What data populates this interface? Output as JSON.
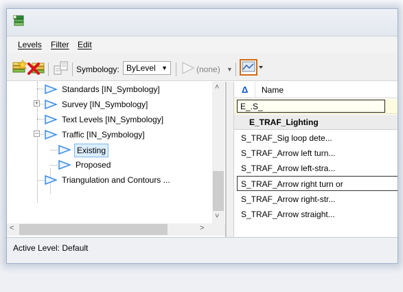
{
  "menu": {
    "levels": "Levels",
    "filter": "Filter",
    "edit": "Edit"
  },
  "toolbar": {
    "symbology_label": "Symbology:",
    "symbology_value": "ByLevel",
    "filter_value": "(none)"
  },
  "tree": {
    "items": [
      {
        "label": "Standards [IN_Symbology]"
      },
      {
        "label": "Survey [IN_Symbology]"
      },
      {
        "label": "Text Levels [IN_Symbology]"
      },
      {
        "label": "Traffic [IN_Symbology]"
      },
      {
        "label": "Existing"
      },
      {
        "label": "Proposed"
      },
      {
        "label": "Triangulation and Contours ..."
      }
    ],
    "expander_plus": "+",
    "expander_minus": "−"
  },
  "list": {
    "sort_glyph": "Δ",
    "column_name": "Name",
    "filter_text": "E_.S_",
    "rows": [
      {
        "name": "E_TRAF_Lighting"
      },
      {
        "name": "S_TRAF_Sig loop dete..."
      },
      {
        "name": "S_TRAF_Arrow left turn..."
      },
      {
        "name": "S_TRAF_Arrow left-stra..."
      },
      {
        "name": "S_TRAF_Arrow right turn or"
      },
      {
        "name": "S_TRAF_Arrow right-str..."
      },
      {
        "name": "S_TRAF_Arrow straight..."
      }
    ]
  },
  "status": {
    "text": "Active Level: Default"
  },
  "colors": {
    "accent": "#0a55d6",
    "folder_blue": "#3a8be0",
    "title_bg": "#e6ebf2"
  }
}
